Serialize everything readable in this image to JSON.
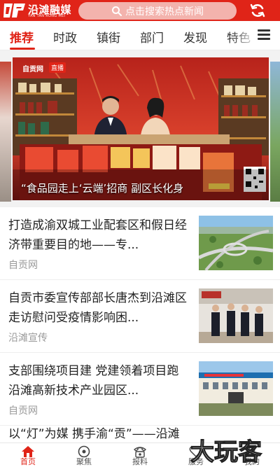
{
  "header": {
    "logo_text": "沿滩融媒",
    "logo_sub": "YAN TAN RONG MEI",
    "search_placeholder": "点击搜索热点新闻",
    "search_icon": "search-icon",
    "refresh_icon": "refresh-icon",
    "brand_color": "#e02418"
  },
  "tabs": [
    {
      "label": "推荐",
      "active": true
    },
    {
      "label": "时政",
      "active": false
    },
    {
      "label": "镇街",
      "active": false
    },
    {
      "label": "部门",
      "active": false
    },
    {
      "label": "发现",
      "active": false
    },
    {
      "label": "特色",
      "active": false
    }
  ],
  "banner": {
    "caption": "“食品园走上‘云端’招商 副区长化身",
    "brand": "自贡网",
    "live_label": "直播"
  },
  "news": [
    {
      "title": "打造成渝双城工业配套区和假日经济带重要目的地——专...",
      "source": "自贡网"
    },
    {
      "title": "自贡市委宣传部部长唐杰到沿滩区走访慰问受疫情影响困...",
      "source": "沿滩宣传"
    },
    {
      "title": "支部围绕项目建 党建领着项目跑 沿滩高新技术产业园区...",
      "source": "自贡网"
    },
    {
      "title": "以“灯”为媒 携手渝“贡”——沿滩",
      "source": ""
    }
  ],
  "bottom_nav": [
    {
      "label": "首页",
      "icon": "home-icon",
      "active": true
    },
    {
      "label": "聚焦",
      "icon": "focus-icon",
      "active": false
    },
    {
      "label": "报料",
      "icon": "phone-icon",
      "active": false
    },
    {
      "label": "服务",
      "icon": "heart-icon",
      "active": false
    },
    {
      "label": "我的",
      "icon": "user-icon",
      "active": false
    }
  ],
  "watermark": "大玩客"
}
